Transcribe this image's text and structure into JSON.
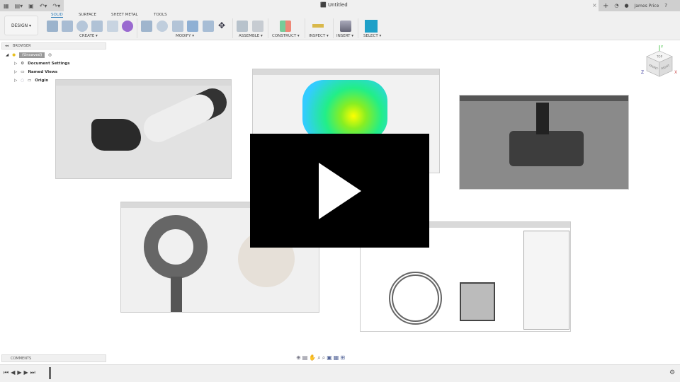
{
  "titlebar": {
    "title": "Untitled",
    "user": "James Price",
    "close": "×",
    "new_tab": "+"
  },
  "ribbon": {
    "workspace": "DESIGN ▾",
    "tabs": [
      "SOLID",
      "SURFACE",
      "SHEET METAL",
      "TOOLS"
    ],
    "groups": [
      "CREATE ▾",
      "MODIFY ▾",
      "ASSEMBLE ▾",
      "CONSTRUCT ▾",
      "INSPECT ▾",
      "INSERT ▾",
      "SELECT ▾"
    ]
  },
  "browser": {
    "title": "BROWSER",
    "root": "(Unsaved)",
    "items": [
      "Document Settings",
      "Named Views",
      "Origin"
    ]
  },
  "comments": {
    "title": "COMMENTS"
  },
  "viewcube": {
    "top": "TOP",
    "front": "FRONT",
    "right": "RIGHT",
    "x": "X",
    "y": "Y",
    "z": "Z"
  },
  "colors": {
    "accent": "#2a7ab8",
    "select": "#1ea0c8"
  }
}
